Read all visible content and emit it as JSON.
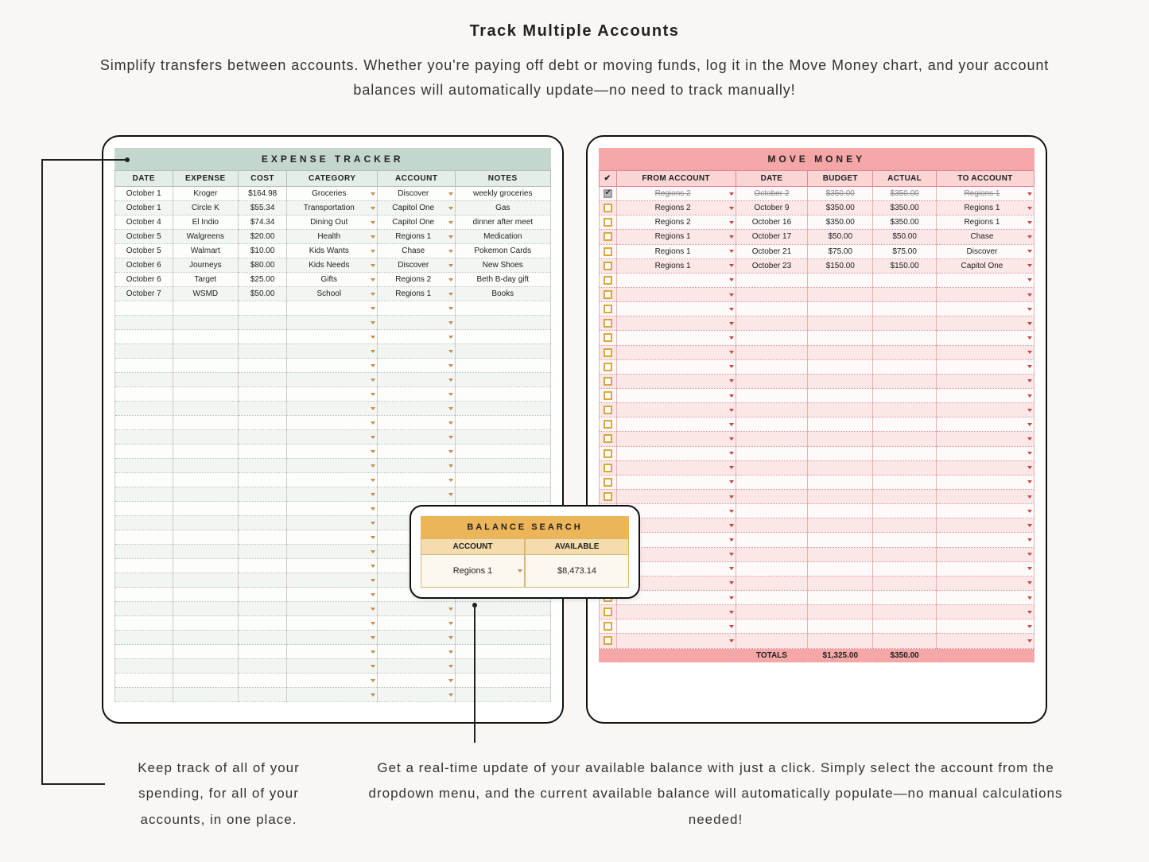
{
  "header": {
    "title": "Track Multiple Accounts",
    "subtitle": "Simplify transfers between accounts. Whether you're paying off debt or moving funds, log it in the Move Money chart, and your account balances will automatically update—no need to track manually!"
  },
  "expense": {
    "title": "EXPENSE TRACKER",
    "columns": [
      "DATE",
      "EXPENSE",
      "COST",
      "CATEGORY",
      "ACCOUNT",
      "NOTES"
    ],
    "rows": [
      {
        "date": "October 1",
        "expense": "Kroger",
        "cost": "$164.98",
        "category": "Groceries",
        "account": "Discover",
        "notes": "weekly groceries"
      },
      {
        "date": "October 1",
        "expense": "Circle K",
        "cost": "$55.34",
        "category": "Transportation",
        "account": "Capitol One",
        "notes": "Gas"
      },
      {
        "date": "October 4",
        "expense": "El Indio",
        "cost": "$74.34",
        "category": "Dining Out",
        "account": "Capitol One",
        "notes": "dinner after meet"
      },
      {
        "date": "October 5",
        "expense": "Walgreens",
        "cost": "$20.00",
        "category": "Health",
        "account": "Regions 1",
        "notes": "Medication"
      },
      {
        "date": "October 5",
        "expense": "Walmart",
        "cost": "$10.00",
        "category": "Kids Wants",
        "account": "Chase",
        "notes": "Pokemon Cards"
      },
      {
        "date": "October 6",
        "expense": "Journeys",
        "cost": "$80.00",
        "category": "Kids Needs",
        "account": "Discover",
        "notes": "New Shoes"
      },
      {
        "date": "October 6",
        "expense": "Target",
        "cost": "$25.00",
        "category": "Gifts",
        "account": "Regions 2",
        "notes": "Beth B-day gift"
      },
      {
        "date": "October 7",
        "expense": "WSMD",
        "cost": "$50.00",
        "category": "School",
        "account": "Regions 1",
        "notes": "Books"
      }
    ],
    "empty_rows": 28
  },
  "move": {
    "title": "MOVE MONEY",
    "columns": [
      "✔",
      "FROM ACCOUNT",
      "DATE",
      "BUDGET",
      "ACTUAL",
      "TO ACCOUNT"
    ],
    "rows": [
      {
        "done": true,
        "from": "Regions 2",
        "date": "October 2",
        "budget": "$350.00",
        "actual": "$350.00",
        "to": "Regions 1"
      },
      {
        "done": false,
        "from": "Regions 2",
        "date": "October 9",
        "budget": "$350.00",
        "actual": "$350.00",
        "to": "Regions 1"
      },
      {
        "done": false,
        "from": "Regions 2",
        "date": "October 16",
        "budget": "$350.00",
        "actual": "$350.00",
        "to": "Regions 1"
      },
      {
        "done": false,
        "from": "Regions 1",
        "date": "October 17",
        "budget": "$50.00",
        "actual": "$50.00",
        "to": "Chase"
      },
      {
        "done": false,
        "from": "Regions 1",
        "date": "October 21",
        "budget": "$75.00",
        "actual": "$75.00",
        "to": "Discover"
      },
      {
        "done": false,
        "from": "Regions 1",
        "date": "October 23",
        "budget": "$150.00",
        "actual": "$150.00",
        "to": "Capitol One"
      }
    ],
    "empty_rows": 26,
    "totals": {
      "label": "TOTALS",
      "budget": "$1,325.00",
      "actual": "$350.00"
    }
  },
  "balance": {
    "title": "BALANCE SEARCH",
    "col_account": "ACCOUNT",
    "col_available": "AVAILABLE",
    "account": "Regions 1",
    "available": "$8,473.14"
  },
  "captions": {
    "left": "Keep track of all of your spending, for all of your accounts, in one place.",
    "right": "Get a real-time update of your available balance with just a click. Simply select the account from the dropdown menu, and the current available balance will automatically populate—no manual calculations needed!"
  }
}
